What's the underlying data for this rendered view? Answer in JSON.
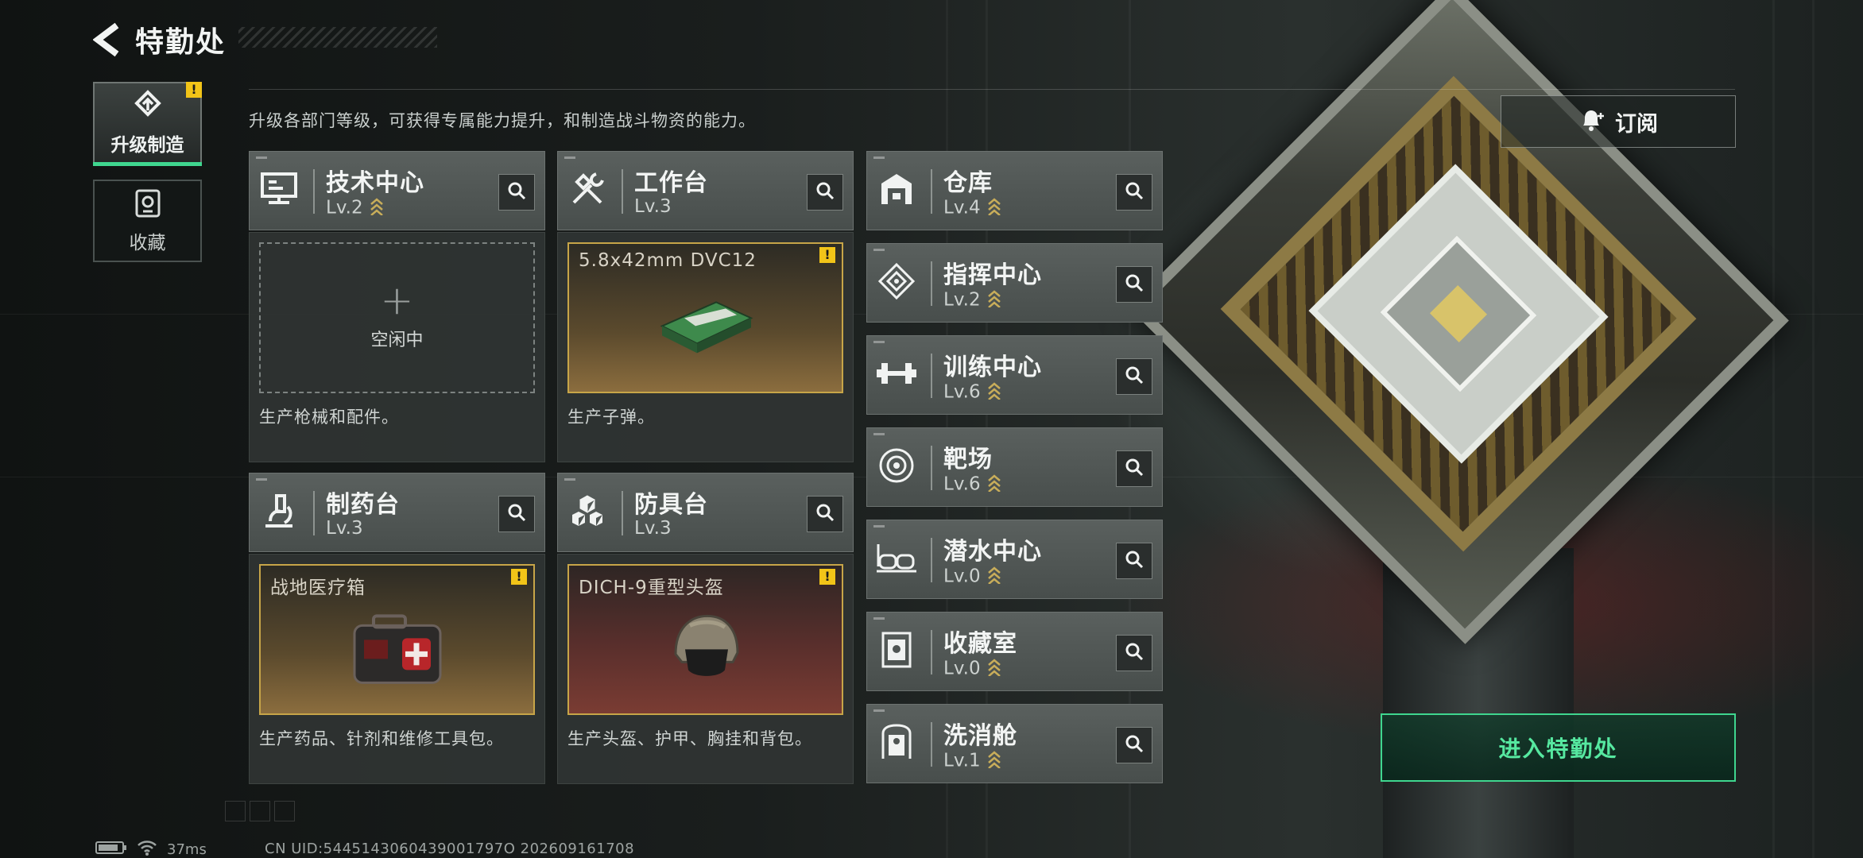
{
  "header": {
    "title": "特勤处"
  },
  "side_tabs": [
    {
      "label": "升级制造",
      "active": true,
      "alert": "!"
    },
    {
      "label": "收藏",
      "active": false
    }
  ],
  "description": "升级各部门等级，可获得专属能力提升，和制造战斗物资的能力。",
  "buildings": [
    {
      "name": "技术中心",
      "level": "Lv.2"
    },
    {
      "name": "工作台",
      "level": "Lv.3"
    },
    {
      "name": "仓库",
      "level": "Lv.4"
    },
    {
      "name": "指挥中心",
      "level": "Lv.2"
    },
    {
      "name": "训练中心",
      "level": "Lv.6"
    },
    {
      "name": "靶场",
      "level": "Lv.6"
    },
    {
      "name": "制药台",
      "level": "Lv.3"
    },
    {
      "name": "防具台",
      "level": "Lv.3"
    },
    {
      "name": "潜水中心",
      "level": "Lv.0"
    },
    {
      "name": "收藏室",
      "level": "Lv.0"
    },
    {
      "name": "洗消舱",
      "level": "Lv.1"
    }
  ],
  "production": {
    "tech": {
      "status": "空闲中",
      "caption": "生产枪械和配件。"
    },
    "workbench": {
      "item": "5.8x42mm DVC12",
      "alert": "!",
      "caption": "生产子弹。"
    },
    "pharmacy": {
      "item": "战地医疗箱",
      "alert": "!",
      "caption": "生产药品、针剂和维修工具包。"
    },
    "armor": {
      "item": "DICH-9重型头盔",
      "alert": "!",
      "caption": "生产头盔、护甲、胸挂和背包。"
    }
  },
  "subscribe": {
    "label": "订阅"
  },
  "enter_button": {
    "label": "进入特勤处"
  },
  "status": {
    "ping": "37ms",
    "uid": "CN UID:5445143060439001797O 202609161708"
  },
  "colors": {
    "accent_green": "#3fd68f",
    "alert_yellow": "#f2c418",
    "card_bg": "#525856"
  }
}
